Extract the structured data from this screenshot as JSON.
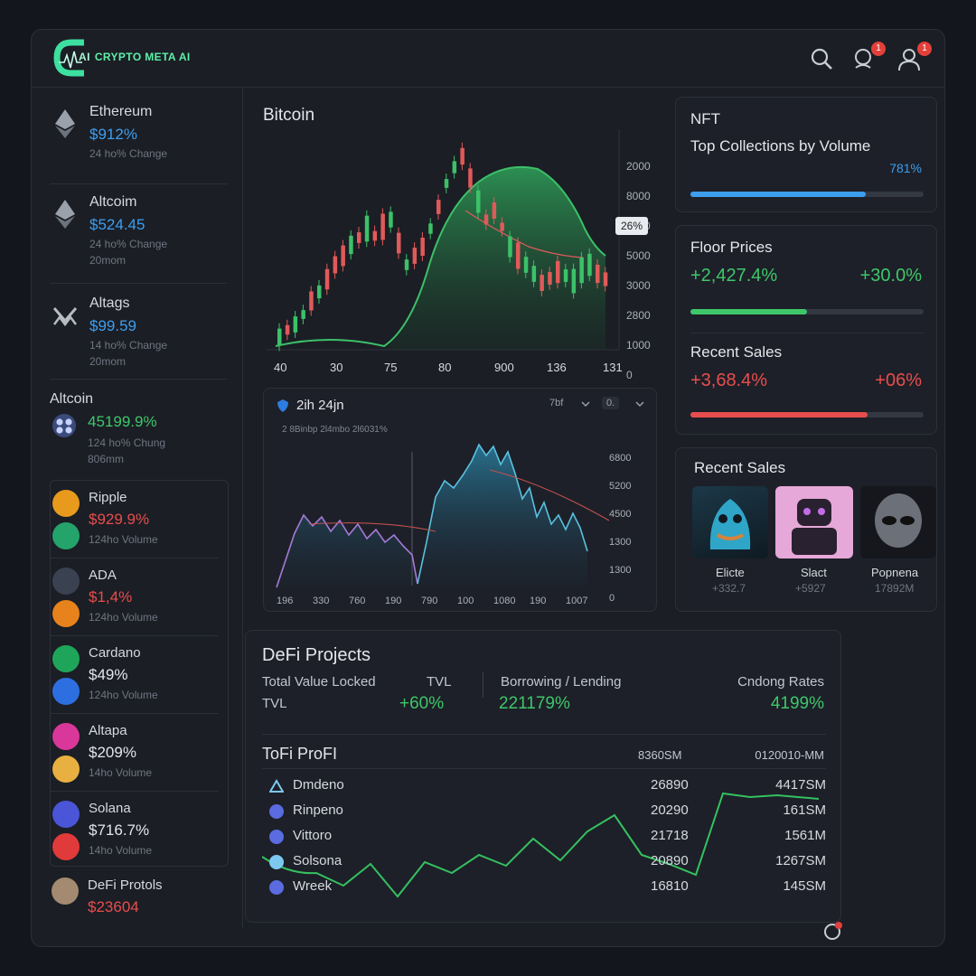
{
  "header": {
    "brand_prefix": "AI",
    "brand_name": "CRYPTO META AI",
    "notifications_badge": "1",
    "profile_badge": "1"
  },
  "sidebar": {
    "top_coins": [
      {
        "name": "Ethereum",
        "price": "$912%",
        "sub": "24 ho% Change",
        "sub2": "",
        "icon": "ethereum-icon"
      },
      {
        "name": "Altcoim",
        "price": "$524.45",
        "sub": "24 ho% Change",
        "sub2": "20mom",
        "icon": "altcoin-diamond-icon"
      },
      {
        "name": "Altags",
        "price": "$99.59",
        "sub": "14 ho% Change",
        "sub2": "20mom",
        "icon": "altags-icon"
      }
    ],
    "altcoin": {
      "title": "Altcoin",
      "value": "45199.9%",
      "sub": "124 ho% Chung",
      "sub2": "806mm"
    },
    "coins": [
      {
        "name": "Ripple",
        "value": "$929.9%",
        "vol": "124ho Volume",
        "color": "#e84d4d",
        "c1": "#e89a1c",
        "c2": "#24a36a"
      },
      {
        "name": "ADA",
        "value": "$1,4%",
        "vol": "124ho Volume",
        "color": "#e84d4d",
        "c1": "#3a4150",
        "c2": "#e8821c"
      },
      {
        "name": "Cardano",
        "value": "$49%",
        "vol": "124ho Volume",
        "color": "#e3e6ea",
        "c1": "#1fa55a",
        "c2": "#2d6fe0"
      },
      {
        "name": "Altapa",
        "value": "$209%",
        "vol": "14ho Volume",
        "color": "#e3e6ea",
        "c1": "#d9379a",
        "c2": "#e8b040"
      },
      {
        "name": "Solana",
        "value": "$716.7%",
        "vol": "14ho Volume",
        "color": "#e3e6ea",
        "c1": "#4a55d8",
        "c2": "#e03a3a"
      },
      {
        "name": "DeFi Protols",
        "value": "$23604",
        "vol": "",
        "color": "#e84d4d",
        "c1": "#a38a70",
        "c2": ""
      }
    ]
  },
  "bitcoin_chart": {
    "title": "Bitcoin",
    "price_tag": "26%",
    "y_labels": [
      "2000",
      "8000",
      "0800",
      "5000",
      "3000",
      "2800",
      "1000",
      "0"
    ],
    "x_labels": [
      "40",
      "30",
      "75",
      "80",
      "900",
      "136",
      "131"
    ]
  },
  "area_chart": {
    "title": "2ih 24jn",
    "subtitle": "2 8Binbp 2l4mbo 2l6031%",
    "control1": "7bf",
    "control2": "0.",
    "y_labels": [
      "6800",
      "5200",
      "4500",
      "1300",
      "1300",
      "0"
    ],
    "x_labels": [
      "196",
      "330",
      "760",
      "190",
      "790",
      "100",
      "1080",
      "190",
      "1007"
    ]
  },
  "nft": {
    "title": "NFT",
    "subtitle": "Top Collections by Volume",
    "percent": "781%",
    "progress": 0.75
  },
  "floor": {
    "title": "Floor Prices",
    "left_value": "+2,427.4%",
    "right_value": "+30.0%",
    "progress": 0.5,
    "recent_title": "Recent Sales",
    "recent_left": "+3,68.4%",
    "recent_right": "+06%",
    "recent_progress": 0.76
  },
  "recent_sales": {
    "title": "Recent Sales",
    "items": [
      {
        "name": "Elicte",
        "value": "+332.7"
      },
      {
        "name": "Slact",
        "value": "+5927"
      },
      {
        "name": "Popnena",
        "value": "17892M"
      }
    ]
  },
  "defi": {
    "title": "DeFi Projects",
    "tvl_label": "Total Value Locked",
    "tvl_short": "TVL",
    "tvl_label2": "TVL",
    "tvl_value": "+60%",
    "borrow_label": "Borrowing / Lending",
    "borrow_value": "221179%",
    "rates_label": "Cndong Rates",
    "rates_value": "4199%",
    "table_title": "ToFi ProFI",
    "col1": "8360SM",
    "col2": "0120010-MM",
    "rows": [
      {
        "name": "Dmdeno",
        "v1": "26890",
        "v2": "4417SM",
        "icon_color": "#7dc8f0"
      },
      {
        "name": "Rinpeno",
        "v1": "20290",
        "v2": "161SM",
        "icon_color": "#5b6be0"
      },
      {
        "name": "Vittoro",
        "v1": "21718",
        "v2": "1561M",
        "icon_color": "#5b6be0"
      },
      {
        "name": "Solsona",
        "v1": "20890",
        "v2": "1267SM",
        "icon_color": "#7dc8f0"
      },
      {
        "name": "Wreek",
        "v1": "16810",
        "v2": "145SM",
        "icon_color": "#5b6be0"
      }
    ]
  }
}
